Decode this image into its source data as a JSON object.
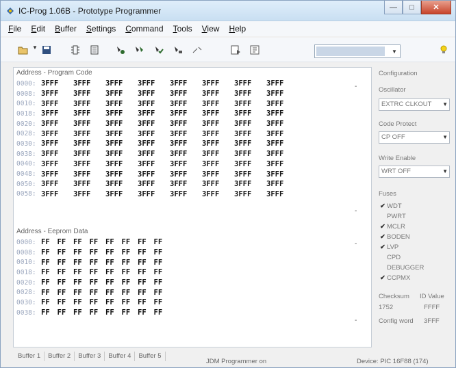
{
  "window": {
    "title": "IC-Prog 1.06B - Prototype Programmer",
    "controls": {
      "minimize": "—",
      "maximize": "□",
      "close": "✕"
    }
  },
  "menu": [
    {
      "key": "F",
      "rest": "ile"
    },
    {
      "key": "E",
      "rest": "dit"
    },
    {
      "key": "B",
      "rest": "uffer"
    },
    {
      "key": "S",
      "rest": "ettings"
    },
    {
      "key": "C",
      "rest": "ommand"
    },
    {
      "key": "T",
      "rest": "ools"
    },
    {
      "key": "V",
      "rest": "iew"
    },
    {
      "key": "H",
      "rest": "elp"
    }
  ],
  "toolbar": {
    "icons": [
      "open-file-icon",
      "save-icon",
      "read-icon",
      "erase-icon",
      "program-icon",
      "program-all-icon",
      "verify-icon",
      "chip-icon",
      "buffer-icon",
      "notes-icon"
    ],
    "device_value": ""
  },
  "program_code": {
    "title": "Address - Program Code",
    "rows": [
      {
        "addr": "0000:",
        "cells": [
          "3FFF",
          "3FFF",
          "3FFF",
          "3FFF",
          "3FFF",
          "3FFF",
          "3FFF",
          "3FFF"
        ]
      },
      {
        "addr": "0008:",
        "cells": [
          "3FFF",
          "3FFF",
          "3FFF",
          "3FFF",
          "3FFF",
          "3FFF",
          "3FFF",
          "3FFF"
        ]
      },
      {
        "addr": "0010:",
        "cells": [
          "3FFF",
          "3FFF",
          "3FFF",
          "3FFF",
          "3FFF",
          "3FFF",
          "3FFF",
          "3FFF"
        ]
      },
      {
        "addr": "0018:",
        "cells": [
          "3FFF",
          "3FFF",
          "3FFF",
          "3FFF",
          "3FFF",
          "3FFF",
          "3FFF",
          "3FFF"
        ]
      },
      {
        "addr": "0020:",
        "cells": [
          "3FFF",
          "3FFF",
          "3FFF",
          "3FFF",
          "3FFF",
          "3FFF",
          "3FFF",
          "3FFF"
        ]
      },
      {
        "addr": "0028:",
        "cells": [
          "3FFF",
          "3FFF",
          "3FFF",
          "3FFF",
          "3FFF",
          "3FFF",
          "3FFF",
          "3FFF"
        ]
      },
      {
        "addr": "0030:",
        "cells": [
          "3FFF",
          "3FFF",
          "3FFF",
          "3FFF",
          "3FFF",
          "3FFF",
          "3FFF",
          "3FFF"
        ]
      },
      {
        "addr": "0038:",
        "cells": [
          "3FFF",
          "3FFF",
          "3FFF",
          "3FFF",
          "3FFF",
          "3FFF",
          "3FFF",
          "3FFF"
        ]
      },
      {
        "addr": "0040:",
        "cells": [
          "3FFF",
          "3FFF",
          "3FFF",
          "3FFF",
          "3FFF",
          "3FFF",
          "3FFF",
          "3FFF"
        ]
      },
      {
        "addr": "0048:",
        "cells": [
          "3FFF",
          "3FFF",
          "3FFF",
          "3FFF",
          "3FFF",
          "3FFF",
          "3FFF",
          "3FFF"
        ]
      },
      {
        "addr": "0050:",
        "cells": [
          "3FFF",
          "3FFF",
          "3FFF",
          "3FFF",
          "3FFF",
          "3FFF",
          "3FFF",
          "3FFF"
        ]
      },
      {
        "addr": "0058:",
        "cells": [
          "3FFF",
          "3FFF",
          "3FFF",
          "3FFF",
          "3FFF",
          "3FFF",
          "3FFF",
          "3FFF"
        ]
      }
    ]
  },
  "eeprom": {
    "title": "Address - Eeprom Data",
    "rows": [
      {
        "addr": "0000:",
        "cells": [
          "FF",
          "FF",
          "FF",
          "FF",
          "FF",
          "FF",
          "FF",
          "FF"
        ]
      },
      {
        "addr": "0008:",
        "cells": [
          "FF",
          "FF",
          "FF",
          "FF",
          "FF",
          "FF",
          "FF",
          "FF"
        ]
      },
      {
        "addr": "0010:",
        "cells": [
          "FF",
          "FF",
          "FF",
          "FF",
          "FF",
          "FF",
          "FF",
          "FF"
        ]
      },
      {
        "addr": "0018:",
        "cells": [
          "FF",
          "FF",
          "FF",
          "FF",
          "FF",
          "FF",
          "FF",
          "FF"
        ]
      },
      {
        "addr": "0020:",
        "cells": [
          "FF",
          "FF",
          "FF",
          "FF",
          "FF",
          "FF",
          "FF",
          "FF"
        ]
      },
      {
        "addr": "0028:",
        "cells": [
          "FF",
          "FF",
          "FF",
          "FF",
          "FF",
          "FF",
          "FF",
          "FF"
        ]
      },
      {
        "addr": "0030:",
        "cells": [
          "FF",
          "FF",
          "FF",
          "FF",
          "FF",
          "FF",
          "FF",
          "FF"
        ]
      },
      {
        "addr": "0038:",
        "cells": [
          "FF",
          "FF",
          "FF",
          "FF",
          "FF",
          "FF",
          "FF",
          "FF"
        ]
      }
    ]
  },
  "buffer_tabs": [
    "Buffer 1",
    "Buffer 2",
    "Buffer 3",
    "Buffer 4",
    "Buffer 5"
  ],
  "configuration": {
    "title": "Configuration",
    "oscillator_label": "Oscillator",
    "oscillator_value": "EXTRC CLKOUT",
    "code_protect_label": "Code Protect",
    "code_protect_value": "CP OFF",
    "write_enable_label": "Write Enable",
    "write_enable_value": "WRT OFF",
    "fuses_label": "Fuses",
    "fuses": [
      {
        "name": "WDT",
        "checked": true
      },
      {
        "name": "PWRT",
        "checked": false
      },
      {
        "name": "MCLR",
        "checked": true
      },
      {
        "name": "BODEN",
        "checked": true
      },
      {
        "name": "LVP",
        "checked": true
      },
      {
        "name": "CPD",
        "checked": false
      },
      {
        "name": "DEBUGGER",
        "checked": false
      },
      {
        "name": "CCPMX",
        "checked": true
      }
    ],
    "checksum_label": "Checksum",
    "checksum_value": "1752",
    "id_value_label": "ID Value",
    "id_value": "FFFF",
    "config_word_label": "Config word",
    "config_word_value": "3FFF"
  },
  "status": {
    "left": "JDM Programmer on",
    "right": "Device: PIC 16F88  (174)"
  }
}
